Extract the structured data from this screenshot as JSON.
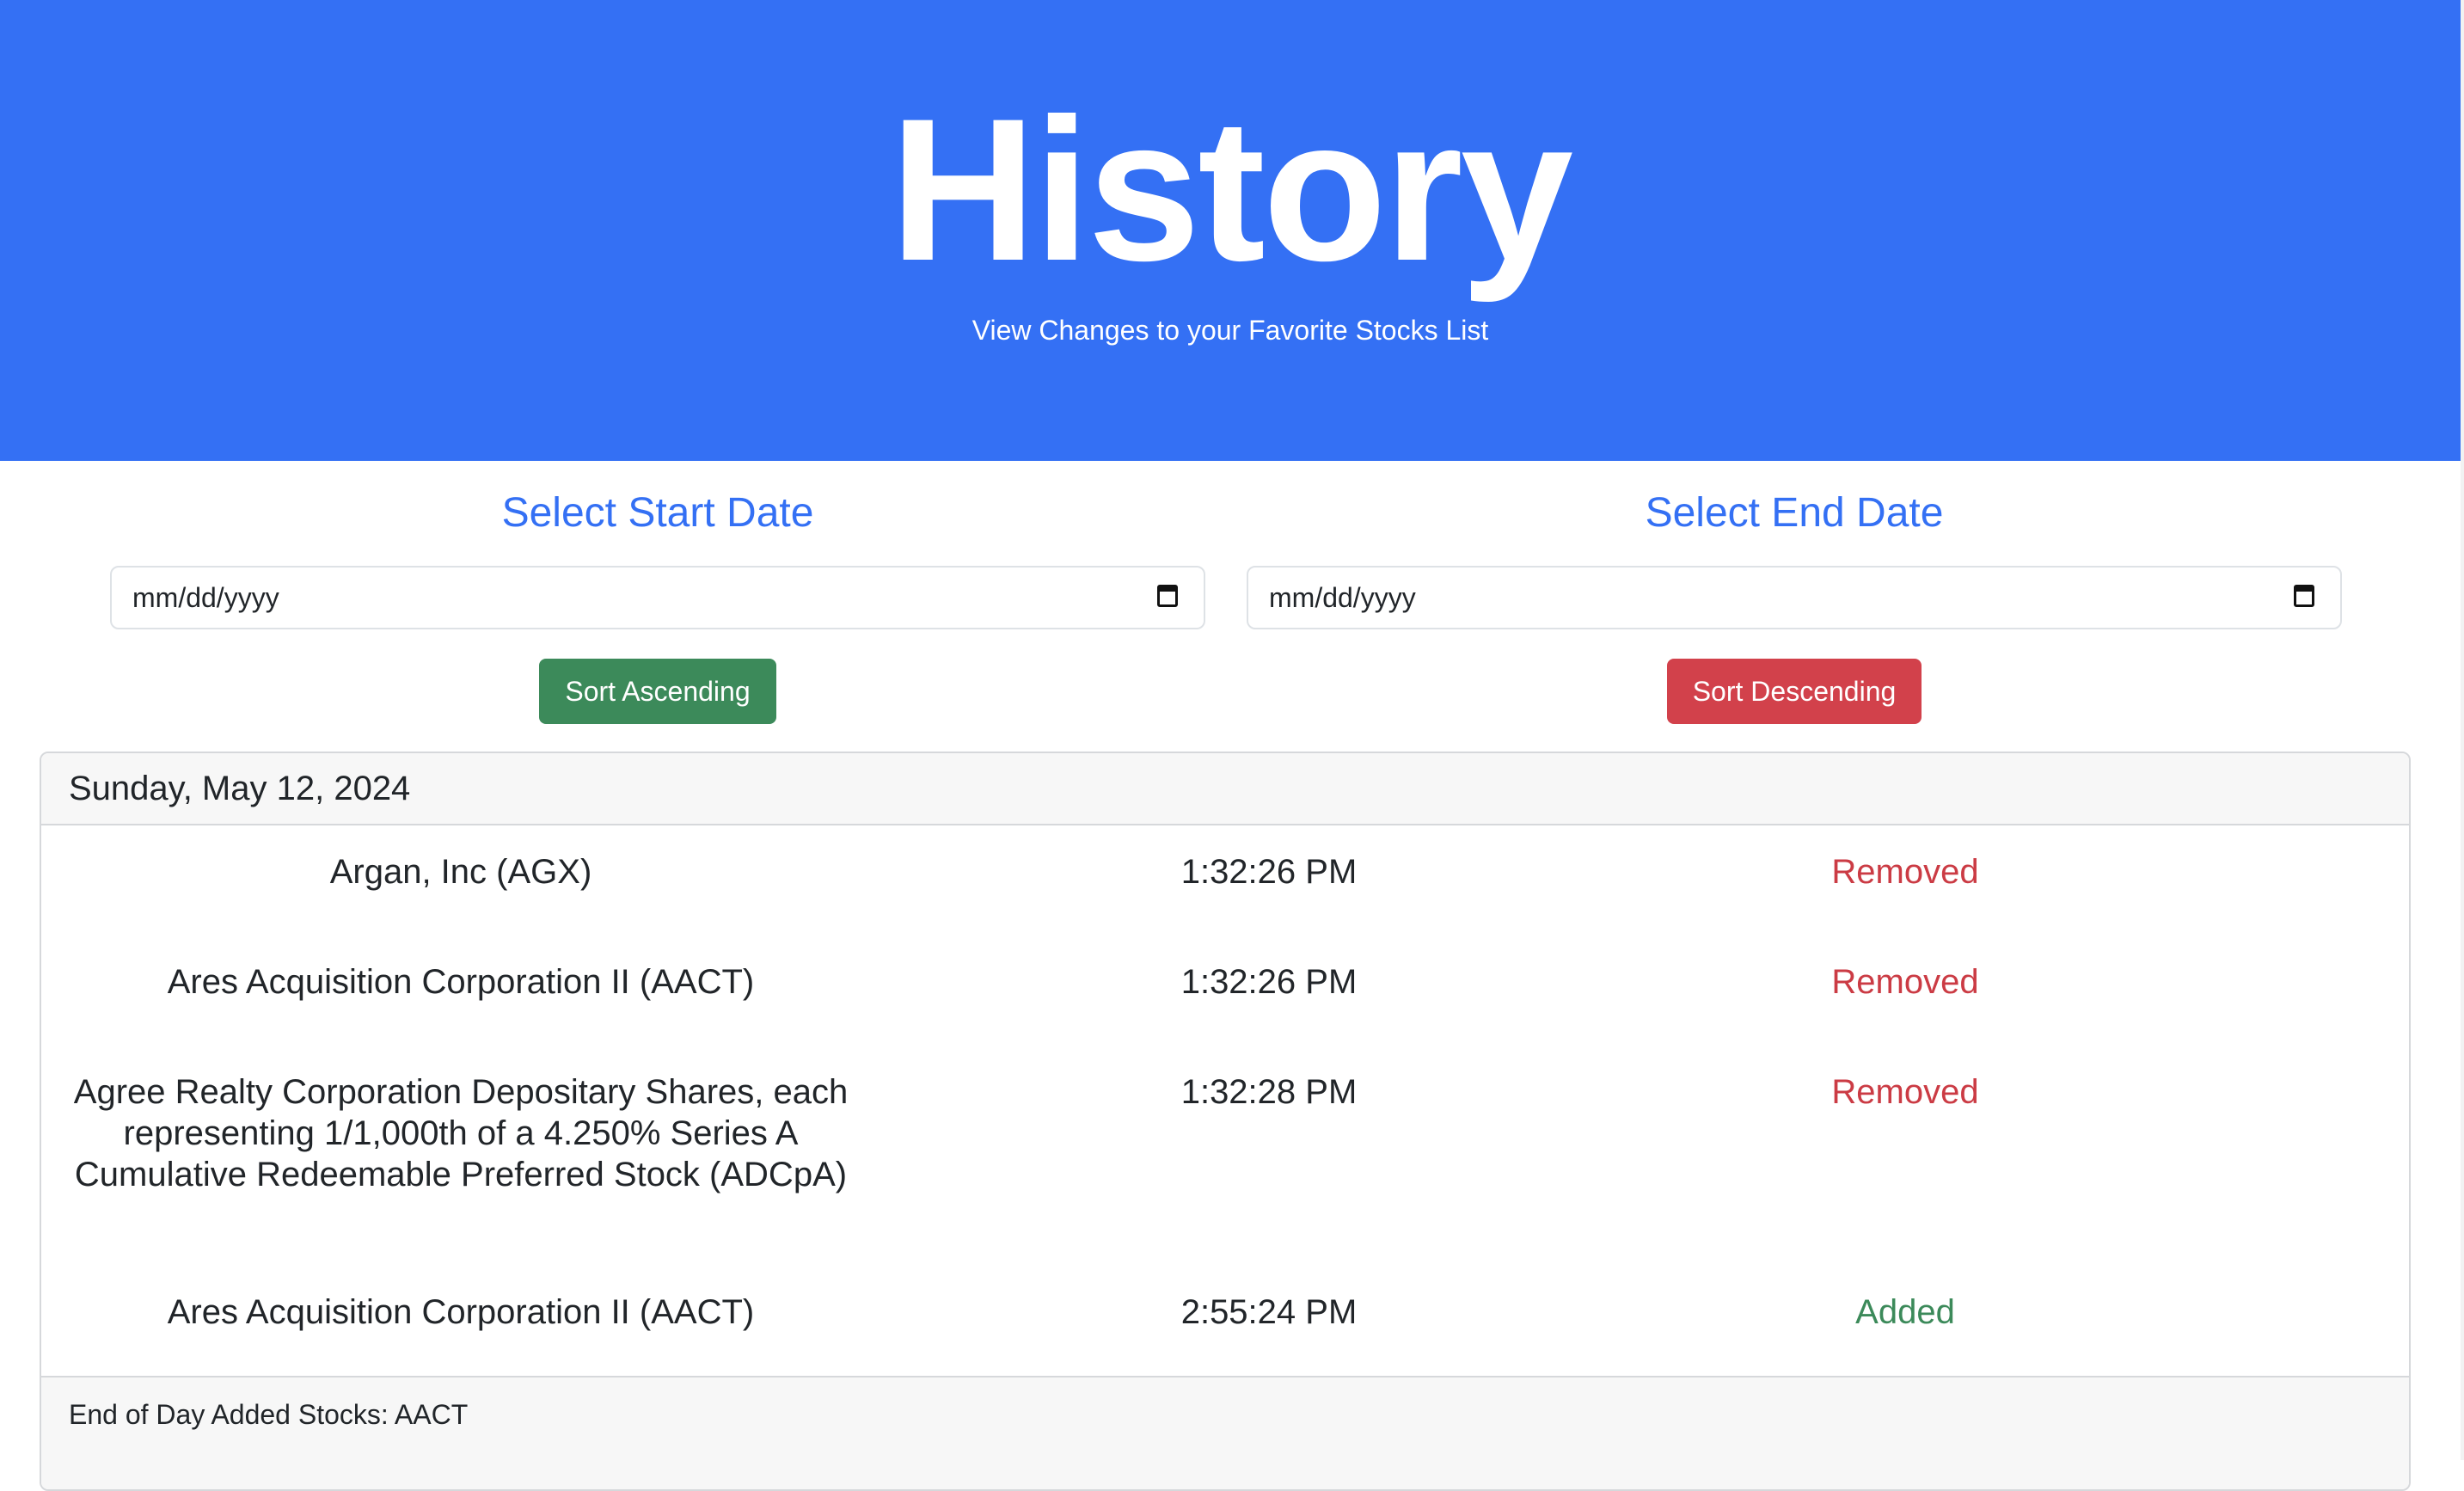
{
  "hero": {
    "title": "History",
    "subtitle": "View Changes to your Favorite Stocks List"
  },
  "filters": {
    "start": {
      "title": "Select Start Date",
      "placeholder": "mm/dd/yyyy",
      "button": "Sort Ascending"
    },
    "end": {
      "title": "Select End Date",
      "placeholder": "mm/dd/yyyy",
      "button": "Sort Descending"
    }
  },
  "day": {
    "header": "Sunday, May 12, 2024",
    "entries": [
      {
        "name": "Argan, Inc (AGX)",
        "time": "1:32:26 PM",
        "status": "Removed"
      },
      {
        "name": "Ares Acquisition Corporation II (AACT)",
        "time": "1:32:26 PM",
        "status": "Removed"
      },
      {
        "name": "Agree Realty Corporation Depositary Shares, each representing 1/1,000th of a 4.250% Series A Cumulative Redeemable Preferred Stock (ADCpA)",
        "time": "1:32:28 PM",
        "status": "Removed"
      },
      {
        "name": "Ares Acquisition Corporation II (AACT)",
        "time": "2:55:24 PM",
        "status": "Added"
      }
    ],
    "footer": "End of Day Added Stocks: AACT"
  },
  "colors": {
    "primary": "#3470f4",
    "success": "#3c8a5a",
    "danger": "#d2414b"
  },
  "icons": {
    "date_picker": "calendar-icon"
  }
}
